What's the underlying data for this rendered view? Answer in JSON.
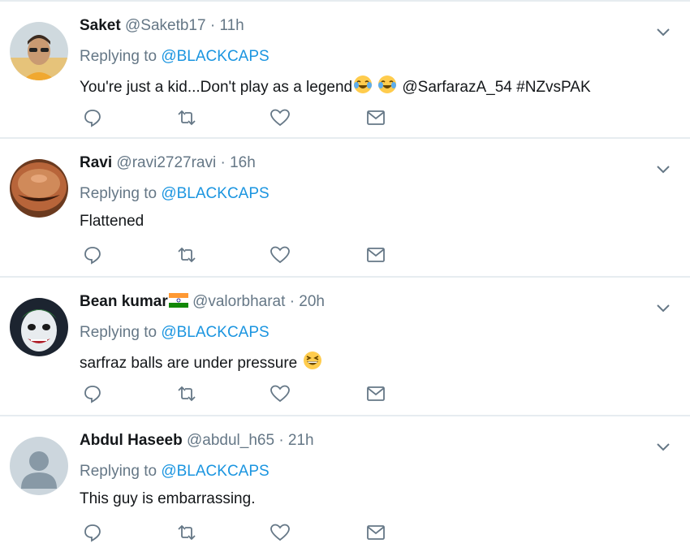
{
  "tweets": [
    {
      "name": "Saket",
      "handle": "@Saketb17",
      "sep": "·",
      "time": "11h",
      "replying_prefix": "Replying to",
      "replying_to": "@BLACKCAPS",
      "text_before": "You're just a kid...Don't play as a legend",
      "text_after": " @SarfarazA_54 #NZvsPAK",
      "emojis": [
        "face-with-tears-of-joy",
        "face-with-tears-of-joy"
      ],
      "avatar": "photo-man-sunglasses"
    },
    {
      "name": "Ravi",
      "handle": "@ravi2727ravi",
      "sep": "·",
      "time": "16h",
      "replying_prefix": "Replying to",
      "replying_to": "@BLACKCAPS",
      "text_before": "Flattened",
      "text_after": "",
      "emojis": [],
      "avatar": "photo-face-closeup"
    },
    {
      "name": "Bean kumar",
      "handle": "@valorbharat",
      "sep": "·",
      "time": "20h",
      "replying_prefix": "Replying to",
      "replying_to": "@BLACKCAPS",
      "text_before": "sarfraz balls are under pressure ",
      "text_after": "",
      "emojis": [
        "grinning-squinting-face"
      ],
      "name_emoji": "india-flag",
      "avatar": "photo-joker-face"
    },
    {
      "name": "Abdul Haseeb",
      "handle": "@abdul_h65",
      "sep": "·",
      "time": "21h",
      "replying_prefix": "Replying to",
      "replying_to": "@BLACKCAPS",
      "text_before": "This guy is embarrassing.",
      "text_after": "",
      "emojis": [],
      "avatar": "default-avatar"
    }
  ],
  "action_icons": [
    "reply-icon",
    "retweet-icon",
    "like-icon",
    "direct-message-icon"
  ],
  "colors": {
    "text": "#14171a",
    "secondary": "#657786",
    "link": "#1b95e0",
    "divider": "#e6ecf0",
    "icon": "#657786"
  }
}
